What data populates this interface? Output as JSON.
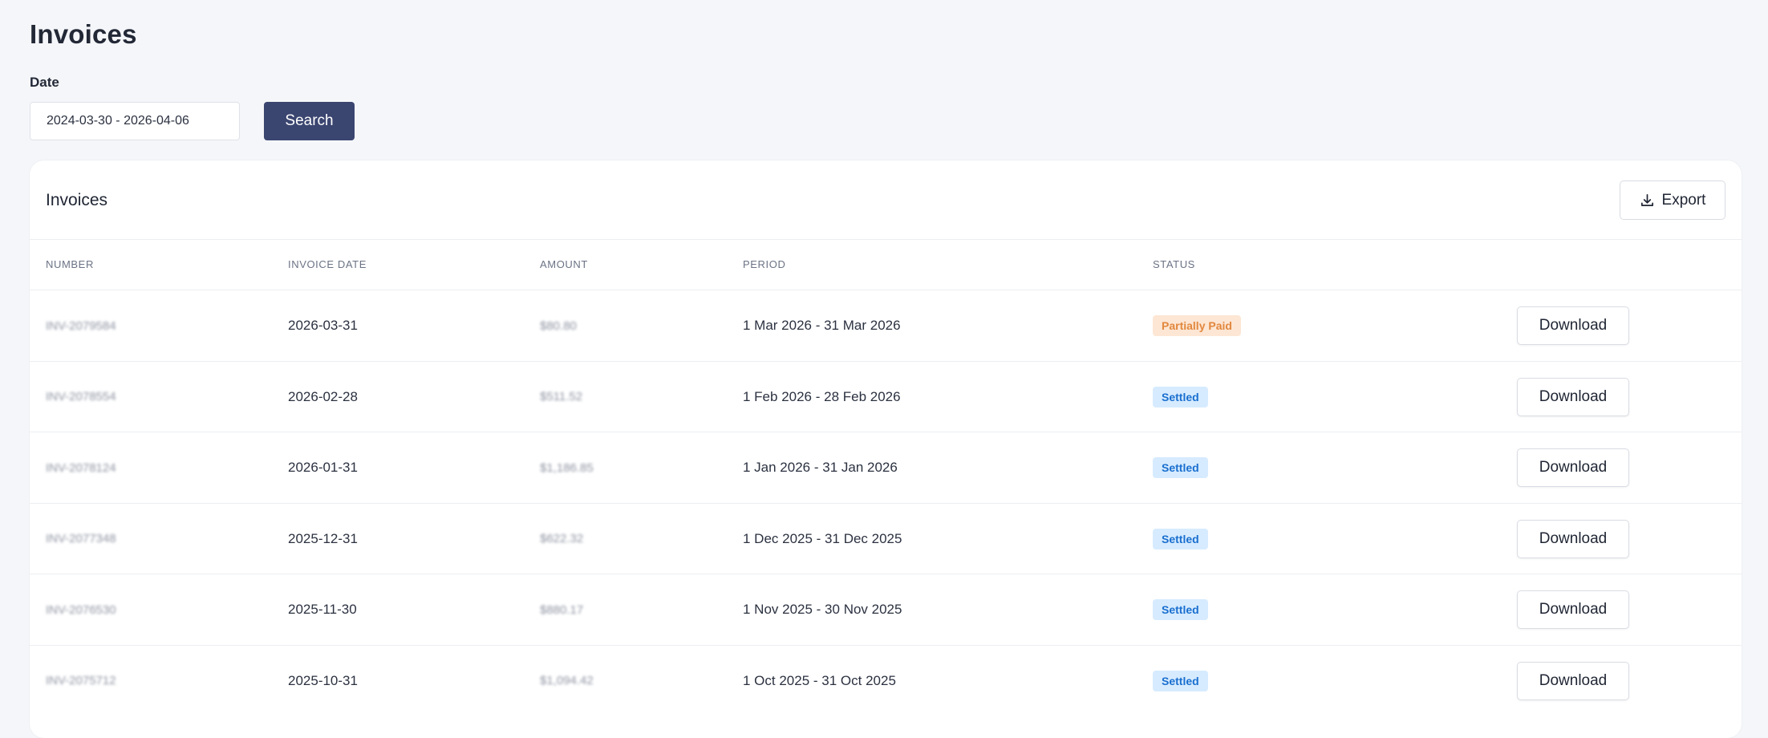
{
  "page": {
    "title": "Invoices"
  },
  "filter": {
    "date_label": "Date",
    "date_value": "2024-03-30 - 2026-04-06",
    "search_label": "Search"
  },
  "card": {
    "title": "Invoices",
    "export_label": "Export",
    "export_icon": "download-icon"
  },
  "table": {
    "columns": [
      "NUMBER",
      "INVOICE DATE",
      "AMOUNT",
      "PERIOD",
      "STATUS"
    ],
    "download_label": "Download",
    "rows": [
      {
        "number": "INV-2079584",
        "invoice_date": "2026-03-31",
        "amount": "$80.80",
        "period": "1 Mar 2026 - 31 Mar 2026",
        "status": "Partially Paid",
        "status_kind": "partial"
      },
      {
        "number": "INV-2078554",
        "invoice_date": "2026-02-28",
        "amount": "$511.52",
        "period": "1 Feb 2026 - 28 Feb 2026",
        "status": "Settled",
        "status_kind": "settled"
      },
      {
        "number": "INV-2078124",
        "invoice_date": "2026-01-31",
        "amount": "$1,186.85",
        "period": "1 Jan 2026 - 31 Jan 2026",
        "status": "Settled",
        "status_kind": "settled"
      },
      {
        "number": "INV-2077348",
        "invoice_date": "2025-12-31",
        "amount": "$622.32",
        "period": "1 Dec 2025 - 31 Dec 2025",
        "status": "Settled",
        "status_kind": "settled"
      },
      {
        "number": "INV-2076530",
        "invoice_date": "2025-11-30",
        "amount": "$880.17",
        "period": "1 Nov 2025 - 30 Nov 2025",
        "status": "Settled",
        "status_kind": "settled"
      },
      {
        "number": "INV-2075712",
        "invoice_date": "2025-10-31",
        "amount": "$1,094.42",
        "period": "1 Oct 2025 - 31 Oct 2025",
        "status": "Settled",
        "status_kind": "settled"
      }
    ]
  },
  "colors": {
    "primary": "#3a4570",
    "settled_bg": "#d6ebff",
    "settled_text": "#1a6fcf",
    "partial_bg": "#fde6d4",
    "partial_text": "#e2883e"
  }
}
